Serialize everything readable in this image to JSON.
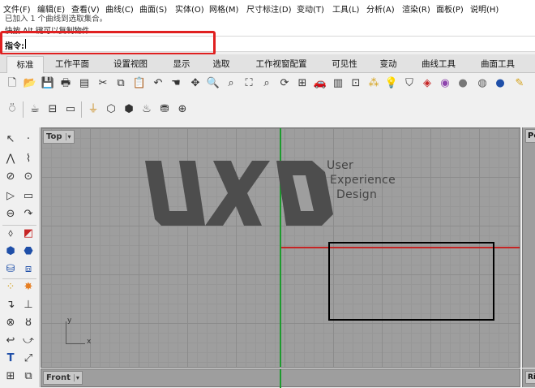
{
  "menu": [
    "文件(F)",
    "编辑(E)",
    "查看(V)",
    "曲线(C)",
    "曲面(S)",
    "实体(O)",
    "网格(M)",
    "尺寸标注(D)",
    "变动(T)",
    "工具(L)",
    "分析(A)",
    "渲染(R)",
    "面板(P)",
    "说明(H)"
  ],
  "history": {
    "line1": "已加入 1 个曲线到选取集合。",
    "line2": "快按 Alt 键可以复制物件"
  },
  "command": {
    "prompt": "指令:",
    "value": ""
  },
  "tabs": [
    "标准",
    "工作平面",
    "设置视图",
    "显示",
    "选取",
    "工作视窗配置",
    "可见性",
    "变动",
    "曲线工具",
    "曲面工具"
  ],
  "toolbar_row1": [
    "new-file-icon",
    "open-file-icon",
    "save-icon",
    "print-icon",
    "import-icon",
    "cut-icon",
    "copy-icon",
    "paste-icon",
    "undo-icon",
    "pan-icon",
    "zoom-in-icon",
    "zoom-window-icon",
    "zoom-extents-icon",
    "zoom-selected-icon",
    "rotate-view-icon",
    "four-viewports-icon",
    "car-icon",
    "viewport-properties-icon",
    "select-filter-icon",
    "light-bulb-icon",
    "layer-icon",
    "color-icon",
    "render-color-icon",
    "shaded-sphere-icon",
    "rendered-sphere-icon",
    "blue-sphere-icon",
    "pencil-icon"
  ],
  "toolbar_row2": [
    "snap-icon",
    "teapot-icon",
    "named-view-icon",
    "viewport-icon",
    "cplane-icon",
    "box-select-icon",
    "grasshopper-icon",
    "plugin-icon",
    "add-icon"
  ],
  "viewport": {
    "title": "Top",
    "logo_text": "UXD",
    "tagline": [
      "User",
      "Experience",
      "Design"
    ],
    "axis_x": "x",
    "axis_y": "y",
    "colors": {
      "green_axis": "#1d9a2e",
      "red_axis": "#c62424",
      "grid": "#9e9e9e"
    }
  },
  "front_viewport": {
    "title": "Front"
  },
  "right_viewport": {
    "title": "Pe",
    "title2": "Ri"
  }
}
